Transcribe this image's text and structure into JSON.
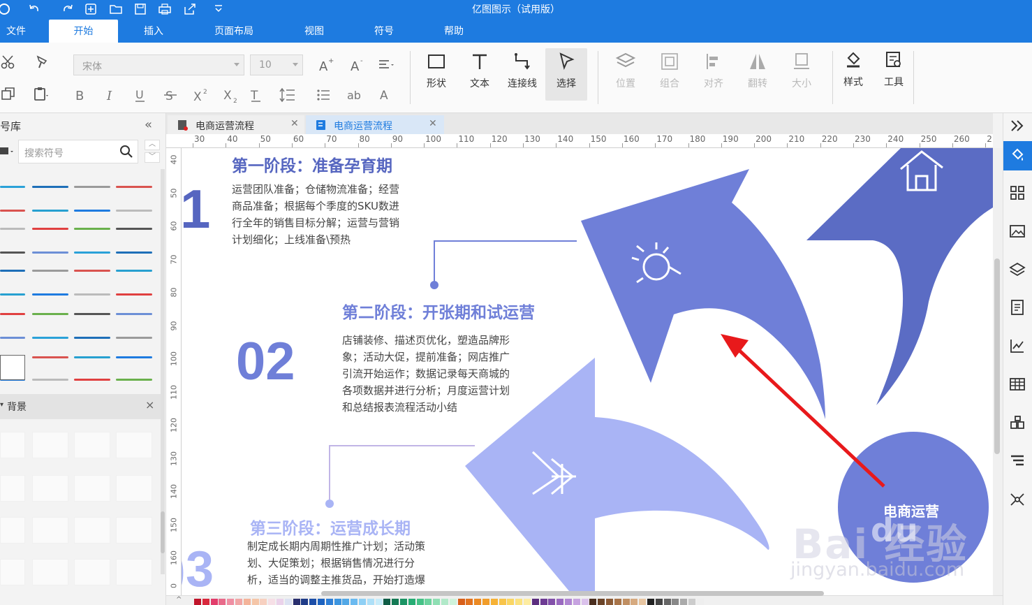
{
  "app": {
    "title": "亿图图示（试用版）"
  },
  "menu": {
    "items": [
      {
        "label": "文件",
        "active": false
      },
      {
        "label": "开始",
        "active": true
      },
      {
        "label": "插入",
        "active": false
      },
      {
        "label": "页面布局",
        "active": false
      },
      {
        "label": "视图",
        "active": false
      },
      {
        "label": "符号",
        "active": false
      },
      {
        "label": "帮助",
        "active": false
      }
    ]
  },
  "ribbon": {
    "font_name": "宋体",
    "font_size": "10",
    "tools": {
      "shape": "形状",
      "text": "文本",
      "connector": "连接线",
      "select": "选择",
      "position": "位置",
      "group": "组合",
      "align": "对齐",
      "flip": "翻转",
      "size": "大小",
      "style": "样式",
      "tools": "工具"
    }
  },
  "library": {
    "title": "号库",
    "search_placeholder": "搜索符号",
    "background_section": "背景"
  },
  "tabs": [
    {
      "label": "电商运营流程",
      "active": false
    },
    {
      "label": "电商运营流程",
      "active": true
    }
  ],
  "ruler": {
    "horizontal": [
      "30",
      "40",
      "50",
      "60",
      "70",
      "80",
      "90",
      "100",
      "110",
      "120",
      "130",
      "140",
      "150",
      "160",
      "170",
      "180",
      "190",
      "200",
      "210",
      "220",
      "230",
      "240",
      "250",
      "260",
      "2"
    ],
    "vertical": [
      "40",
      "50",
      "60",
      "70",
      "80",
      "90",
      "100",
      "110",
      "120",
      "130",
      "140",
      "150",
      "160",
      "0"
    ]
  },
  "diagram": {
    "stage1": {
      "title": "第一阶段：准备孕育期",
      "number": "1",
      "lines": [
        "运营团队准备；仓储物流准备；经营",
        "商品准备；根据每个季度的SKU数进",
        "行全年的销售目标分解；运营与营销",
        "计划细化；上线准备\\预热"
      ]
    },
    "stage2": {
      "title": "第二阶段：开张期和试运营",
      "number": "02",
      "lines": [
        "店铺装修、描述页优化，塑造品牌形",
        "象；活动大促，提前准备；网店推广",
        "引流开始运作；数据记录每天商城的",
        "各项数据并进行分析；月度运营计划",
        "和总结报表流程活动小结"
      ]
    },
    "stage3": {
      "title": "第三阶段：运营成长期",
      "number": ")3",
      "lines": [
        "制定成长期内周期性推广计划；活动策",
        "划、大促策划；根据销售情况进行分",
        "析，适当的调整主推货品，开始打造爆"
      ]
    },
    "center_label": "电商运营",
    "colors": {
      "arrow_dark": "#5b6cc4",
      "arrow_mid": "#6f7fd8",
      "arrow_light": "#a9b4f5",
      "red_arrow": "#e8191b",
      "title_blue": "#5666c0"
    }
  },
  "watermark": {
    "main": "Bai 经验",
    "du": "du",
    "url": "jingyan.baidu.com"
  }
}
